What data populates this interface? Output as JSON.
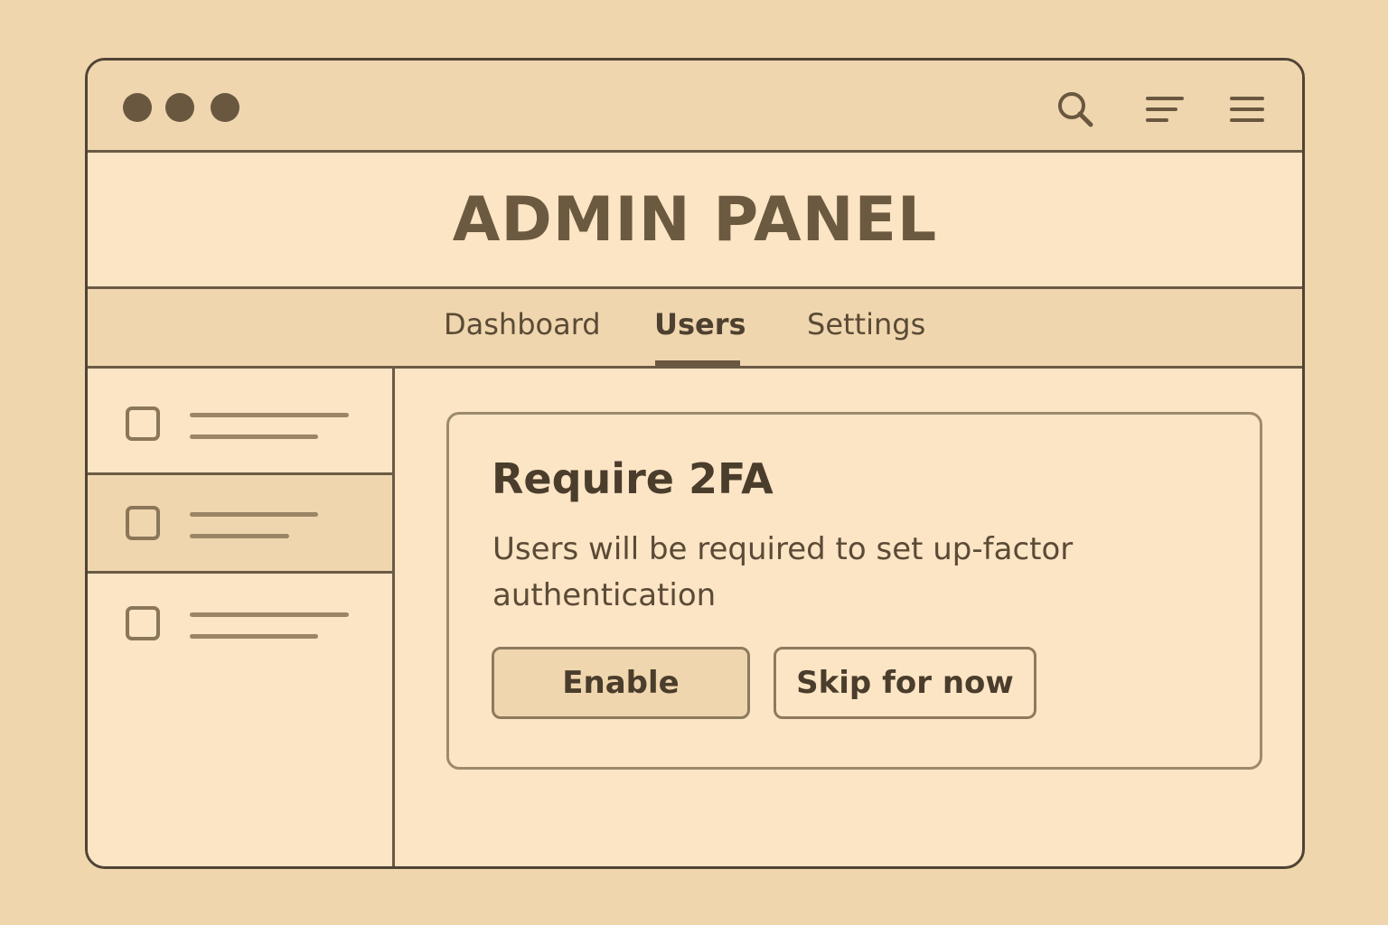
{
  "window": {
    "controls": [
      "window-dot",
      "window-dot",
      "window-dot"
    ],
    "toolbar_icons": [
      "search-icon",
      "text-align-icon",
      "menu-icon"
    ]
  },
  "header": {
    "title": "ADMIN PANEL"
  },
  "tabs": [
    {
      "label": "Dashboard",
      "active": false
    },
    {
      "label": "Users",
      "active": true
    },
    {
      "label": "Settings",
      "active": false
    }
  ],
  "sidebar": {
    "items": [
      {
        "selected": false,
        "checked": false
      },
      {
        "selected": true,
        "checked": false
      },
      {
        "selected": false,
        "checked": false
      }
    ]
  },
  "card": {
    "title": "Require 2FA",
    "description": "Users will be required to set up-factor authentication",
    "enable_label": "Enable",
    "skip_label": "Skip for now"
  },
  "colors": {
    "page_background": "#f0d6ac",
    "window_background": "#fbe5c5",
    "bar_background": "#efd6ae",
    "border": "#4f4434",
    "text": "#4b3d2c"
  }
}
